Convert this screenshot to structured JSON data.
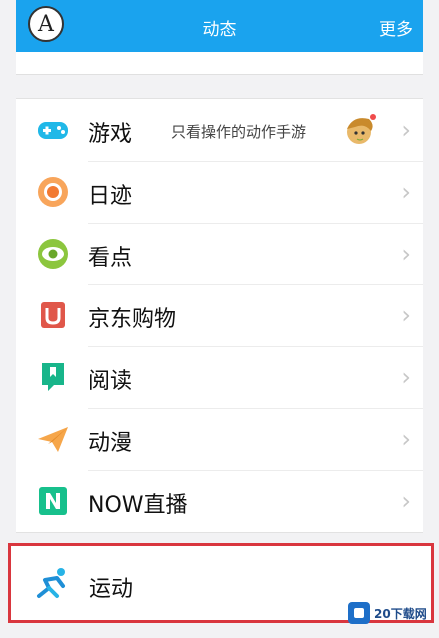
{
  "header": {
    "avatar_letter": "A",
    "title": "动态",
    "more_label": "更多"
  },
  "menu": {
    "items": [
      {
        "label": "游戏",
        "subtitle": "只看操作的动作手游"
      },
      {
        "label": "日迹"
      },
      {
        "label": "看点"
      },
      {
        "label": "京东购物"
      },
      {
        "label": "阅读"
      },
      {
        "label": "动漫"
      },
      {
        "label": "NOW直播"
      }
    ],
    "chevron": "›"
  },
  "highlight": {
    "label": "运动",
    "border_color": "#d9363e"
  },
  "watermark": {
    "text": "20下载网"
  },
  "colors": {
    "header_bg": "#1aa3ee"
  }
}
